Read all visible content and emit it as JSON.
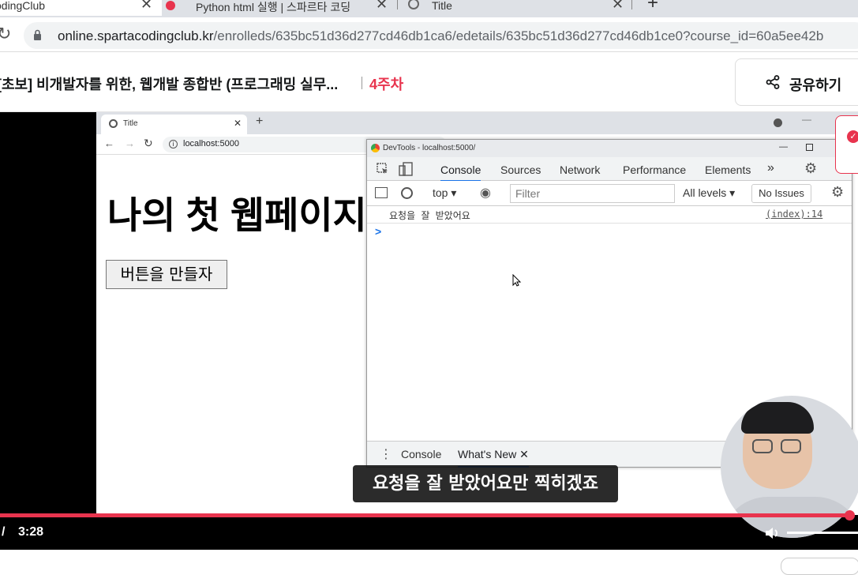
{
  "browser": {
    "tabs": [
      {
        "label": "odingClub"
      },
      {
        "label": "Python html 실행 | 스파르타 코딩"
      },
      {
        "label": "Title"
      }
    ],
    "url_host": "online.spartacodingclub.kr",
    "url_path": "/enrolleds/635bc51d36d277cd46db1ca6/edetails/635bc51d36d277cd46db1ce0?course_id=60a5ee42b"
  },
  "course": {
    "title": "[초보] 비개발자를 위한, 웹개발 종합반 (프로그래밍 실무...",
    "week": "4주차",
    "share_label": "공유하기"
  },
  "inner_browser": {
    "tab_title": "Title",
    "url": "localhost:5000",
    "heading": "나의 첫 웹페이지",
    "button_label": "버튼을 만들자"
  },
  "devtools": {
    "window_title": "DevTools - localhost:5000/",
    "tabs": [
      "Console",
      "Sources",
      "Network",
      "Performance",
      "Elements"
    ],
    "context": "top",
    "filter_placeholder": "Filter",
    "levels": "All levels",
    "issues": "No Issues",
    "log_message": "요청을 잘 받았어요",
    "log_source": "(index):14",
    "prompt": ">",
    "drawer_tabs": [
      "Console",
      "What's New"
    ]
  },
  "video": {
    "subtitle": "요청을 잘 받았어요만 찍히겠죠",
    "time_separator": "/",
    "duration": "3:28",
    "progress": 0.99
  },
  "colors": {
    "accent": "#e8344e",
    "devtools_blue": "#1a73e8"
  }
}
